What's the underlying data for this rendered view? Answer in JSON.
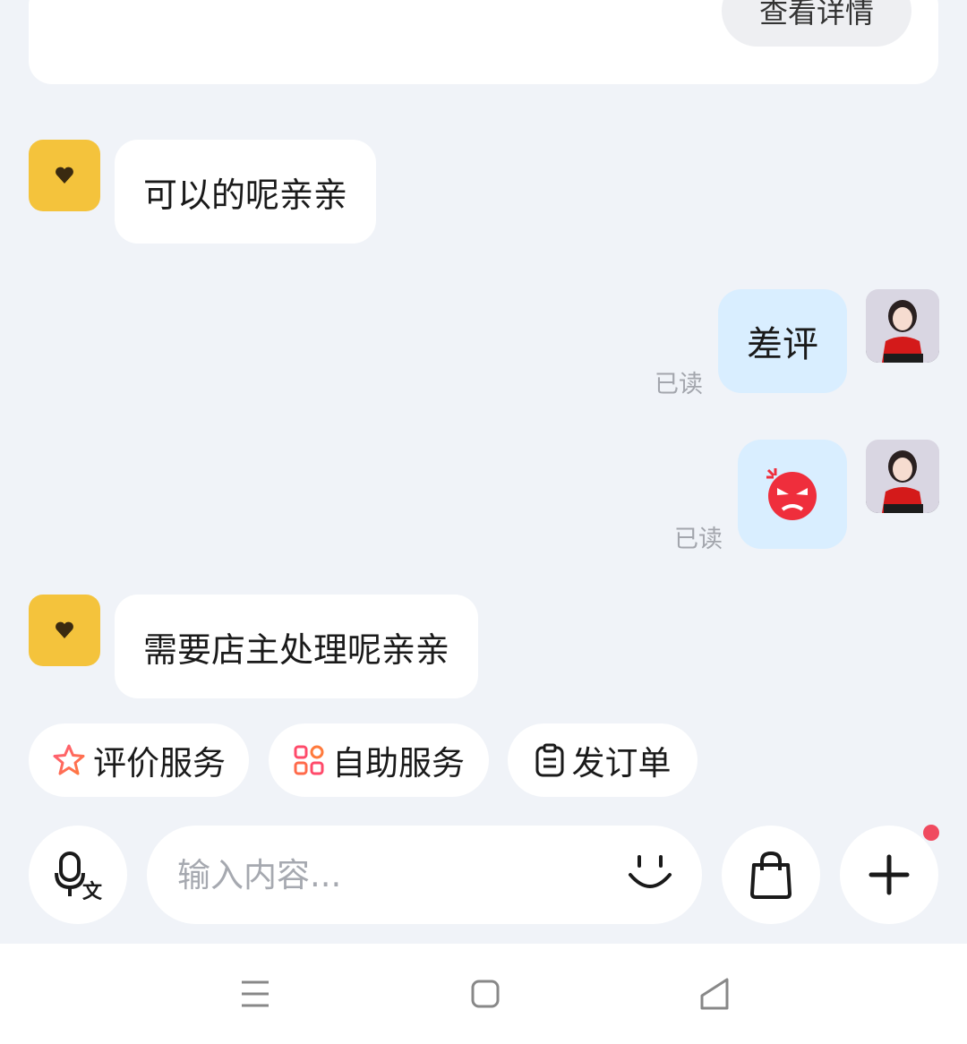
{
  "order_card": {
    "detail_label": "查看详情"
  },
  "messages": [
    {
      "from": "bot",
      "text": "可以的呢亲亲"
    },
    {
      "from": "user",
      "text": "差评",
      "status": "已读"
    },
    {
      "from": "user",
      "emoji": "😡",
      "status": "已读"
    },
    {
      "from": "bot",
      "text": "需要店主处理呢亲亲"
    }
  ],
  "quick_actions": [
    {
      "label": "评价服务",
      "icon": "star-icon"
    },
    {
      "label": "自助服务",
      "icon": "grid-icon"
    },
    {
      "label": "发订单",
      "icon": "clipboard-icon"
    }
  ],
  "composer": {
    "placeholder": "输入内容..."
  },
  "colors": {
    "bot_avatar": "#f4c33c",
    "user_bubble": "#d9eeff",
    "badge": "#f04a5f",
    "background": "#f0f3f8"
  }
}
